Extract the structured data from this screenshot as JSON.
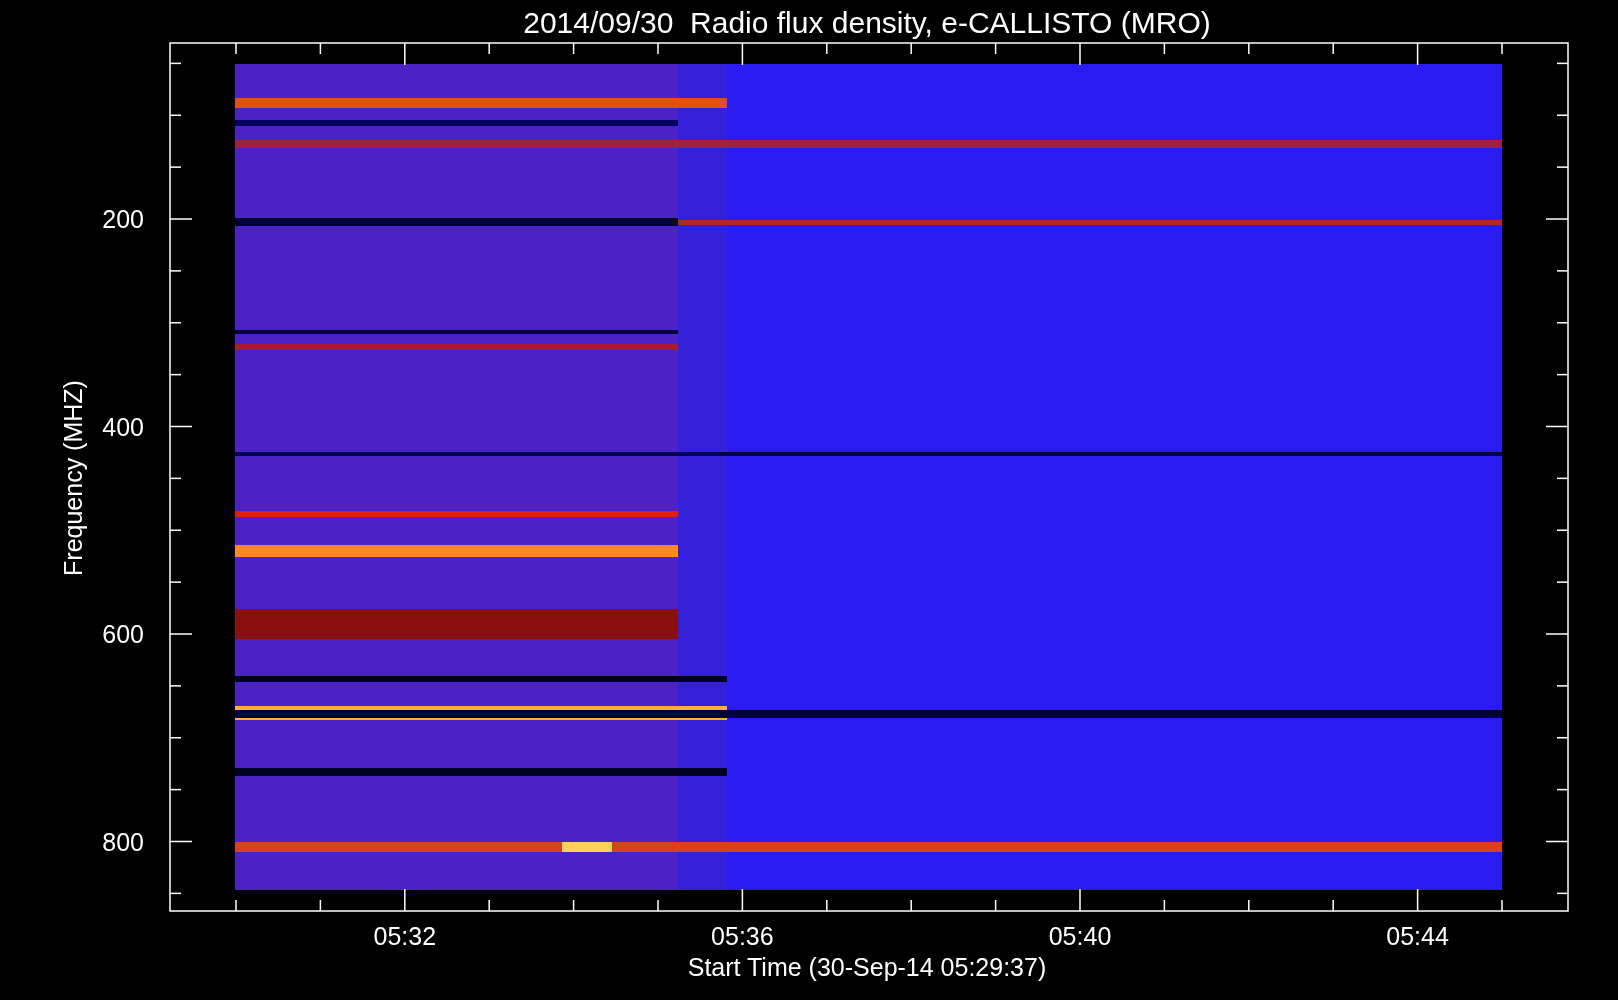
{
  "title": "2014/09/30  Radio flux density, e-CALLISTO (MRO)",
  "y_axis": {
    "label": "Frequency (MHZ)",
    "ticks": [
      "200",
      "400",
      "600",
      "800"
    ]
  },
  "x_axis": {
    "label": "Start Time (30-Sep-14 05:29:37)",
    "ticks": [
      "05:32",
      "05:36",
      "05:40",
      "05:44"
    ]
  }
}
